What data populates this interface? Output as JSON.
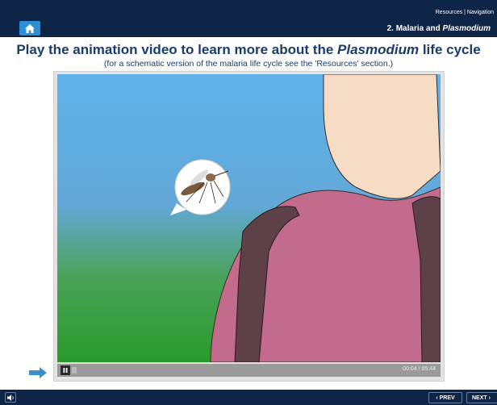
{
  "header": {
    "links": "Resources | Navigation",
    "section_prefix": "2. Malaria and ",
    "section_italic": "Plasmodium",
    "home_icon": "home-icon"
  },
  "main": {
    "heading_prefix": "Play the animation video to learn more about the ",
    "heading_italic": "Plasmodium",
    "heading_suffix": " life cycle",
    "subheading": "(for a schematic version of the malaria life cycle see the 'Resources' section.)"
  },
  "video": {
    "current_time": "00:04",
    "duration": "05:44",
    "time_display": "00:04 / 05:44",
    "progress_fraction": 0.012,
    "play_state_icon": "pause-icon"
  },
  "footer": {
    "prev_label": "‹ PREV",
    "next_label": "NEXT ›",
    "sound_icon": "speaker-icon"
  }
}
